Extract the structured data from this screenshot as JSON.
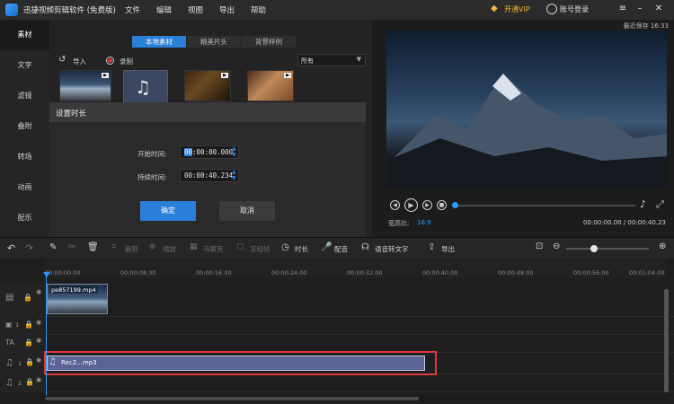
{
  "app": {
    "title": "迅捷视频剪辑软件 (免费版)",
    "menu": [
      "文件",
      "编辑",
      "视图",
      "导出",
      "帮助"
    ],
    "vip_label": "开通VIP",
    "login_label": "账号登录",
    "last_saved": "最近保存 16:33"
  },
  "sidebar": {
    "items": [
      {
        "label": "素材",
        "active": true
      },
      {
        "label": "文字"
      },
      {
        "label": "滤镜"
      },
      {
        "label": "叠附"
      },
      {
        "label": "转场"
      },
      {
        "label": "动画"
      },
      {
        "label": "配乐"
      }
    ]
  },
  "materials": {
    "tabs": [
      {
        "label": "本地素材",
        "active": true
      },
      {
        "label": "精美片头"
      },
      {
        "label": "背景样例"
      }
    ],
    "import_label": "导入",
    "record_label": "录制",
    "filter_value": "所有"
  },
  "dialog": {
    "title": "设置时长",
    "start_label": "开始时间:",
    "start_value_sel": "00",
    "start_value_rest": ":00:00.000",
    "duration_label": "持续时间:",
    "duration_value": "00:00:40.234",
    "ok_label": "确定",
    "cancel_label": "取消"
  },
  "preview": {
    "aspect_label": "宽高比:",
    "aspect_value": "16:9",
    "time_display": "00:00:00.00 / 00:00:40.23"
  },
  "toolbar": {
    "items": [
      {
        "label": "裁剪",
        "enabled": false
      },
      {
        "label": "缩放",
        "enabled": false
      },
      {
        "label": "马赛克",
        "enabled": false
      },
      {
        "label": "冻结帧",
        "enabled": false
      },
      {
        "label": "时长",
        "enabled": true
      },
      {
        "label": "配音",
        "enabled": true
      },
      {
        "label": "语音转文字",
        "enabled": true
      },
      {
        "label": "导出",
        "enabled": true
      }
    ]
  },
  "timeline": {
    "ticks": [
      "00:00:00.00",
      "00:00:08.00",
      "00:00:16.00",
      "00:00:24.00",
      "00:00:32.00",
      "00:00:40.00",
      "00:00:48.00",
      "00:00:56.00",
      "00:01:04.00"
    ],
    "video_clip_label": "pe857199.mp4",
    "audio_clip_label": "Rec2...mp3",
    "track_numbers": [
      "1",
      "2"
    ],
    "colors": {
      "accent": "#2a7fd8",
      "audio_clip": "#5a6394",
      "highlight": "#e0393e"
    }
  }
}
